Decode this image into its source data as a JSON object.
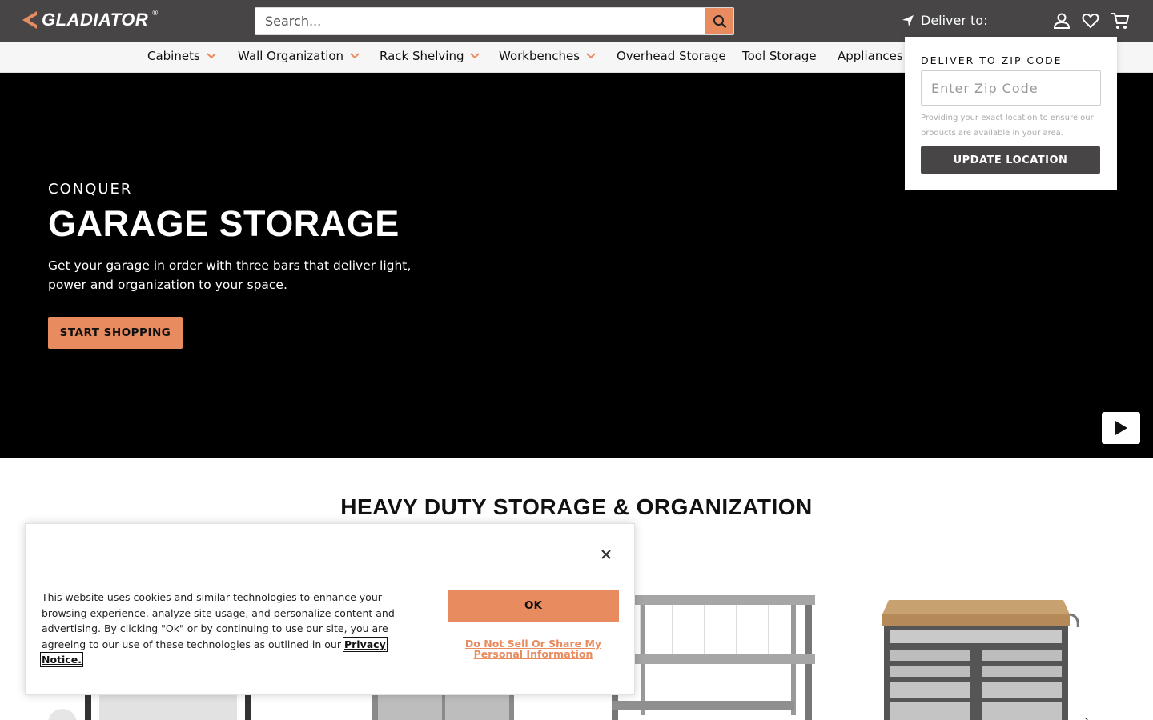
{
  "header": {
    "brand": "GLADIATOR",
    "brand_mark": "®",
    "search_placeholder": "Search...",
    "deliver_label": "Deliver to:"
  },
  "nav": {
    "items": [
      {
        "label": "Cabinets",
        "has_menu": true
      },
      {
        "label": "Wall Organization",
        "has_menu": true
      },
      {
        "label": "Rack Shelving",
        "has_menu": true
      },
      {
        "label": "Workbenches",
        "has_menu": true
      },
      {
        "label": "Overhead Storage",
        "has_menu": false
      },
      {
        "label": "Tool Storage",
        "has_menu": false
      },
      {
        "label": "Appliances",
        "has_menu": false
      }
    ]
  },
  "hero": {
    "kicker": "CONQUER",
    "title": "GARAGE STORAGE",
    "description": "Get your garage in order with three bars that deliver light, power and organization to your space.",
    "cta": "START SHOPPING"
  },
  "section": {
    "title": "HEAVY DUTY STORAGE & ORGANIZATION"
  },
  "zip_popover": {
    "title": "DELIVER TO ZIP CODE",
    "placeholder": "Enter Zip Code",
    "help": "Providing your exact location to ensure our products are available in your area.",
    "button": "UPDATE LOCATION"
  },
  "cookie": {
    "text": "This website uses cookies and similar technologies to enhance your browsing experience, analyze site usage, and personalize content and advertising. By clicking \"Ok\" or by continuing to use our site, you are agreeing to our use of these technologies as outlined in our",
    "link": "Privacy Notice.",
    "ok": "OK",
    "do_not_sell": "Do Not Sell Or Share My Personal Information"
  },
  "colors": {
    "accent": "#e88b5e",
    "header_bg": "#474546",
    "hero_bg": "#000000"
  }
}
